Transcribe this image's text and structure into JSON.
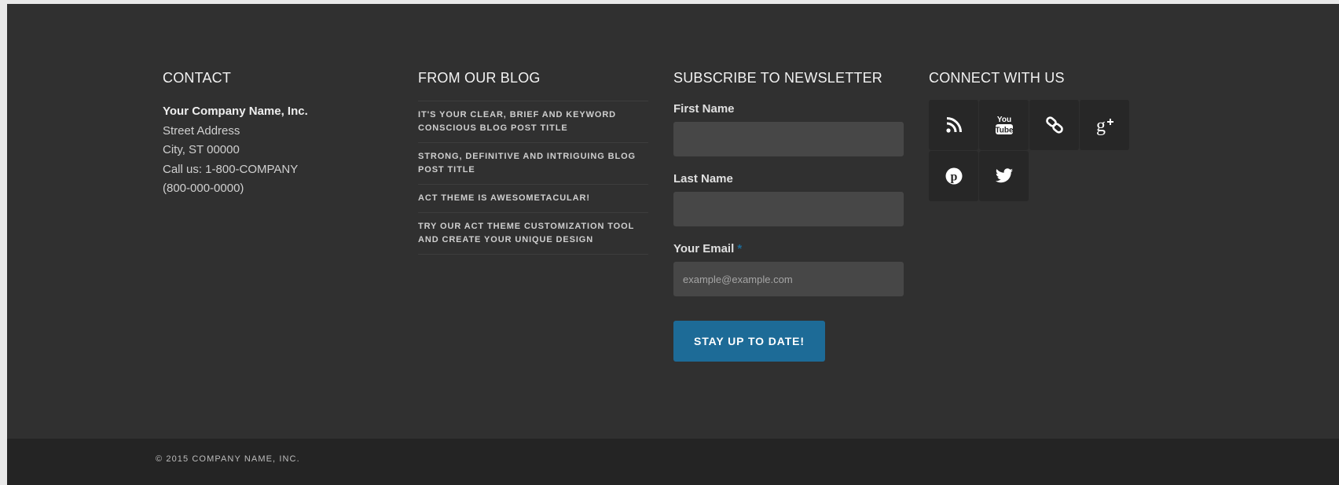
{
  "contact": {
    "title": "Contact",
    "company": "Your Company Name, Inc.",
    "street": "Street Address",
    "city": "City, ST 00000",
    "call": "Call us: 1-800-COMPANY",
    "phone": "(800-000-0000)"
  },
  "blog": {
    "title": "From Our Blog",
    "posts": [
      "It's your clear, brief and keyword conscious blog post title",
      "Strong, definitive and intriguing blog post title",
      "Act Theme is Awesometacular!",
      "Try our Act Theme customization tool and create your unique design"
    ]
  },
  "newsletter": {
    "title": "Subscribe to Newsletter",
    "first_name_label": "First Name",
    "last_name_label": "Last Name",
    "email_label": "Your Email",
    "required_mark": "*",
    "email_placeholder": "example@example.com",
    "submit_label": "Stay up to date!"
  },
  "social": {
    "title": "Connect With Us",
    "icons": [
      "rss-icon",
      "youtube-icon",
      "link-icon",
      "google-plus-icon",
      "pinterest-icon",
      "twitter-icon"
    ]
  },
  "footer": {
    "copyright": "© 2015 Company Name, Inc."
  },
  "colors": {
    "background": "#303030",
    "bottom_bar": "#242424",
    "accent": "#1d6b97",
    "input_bg": "#474747",
    "social_bg": "#272727"
  }
}
